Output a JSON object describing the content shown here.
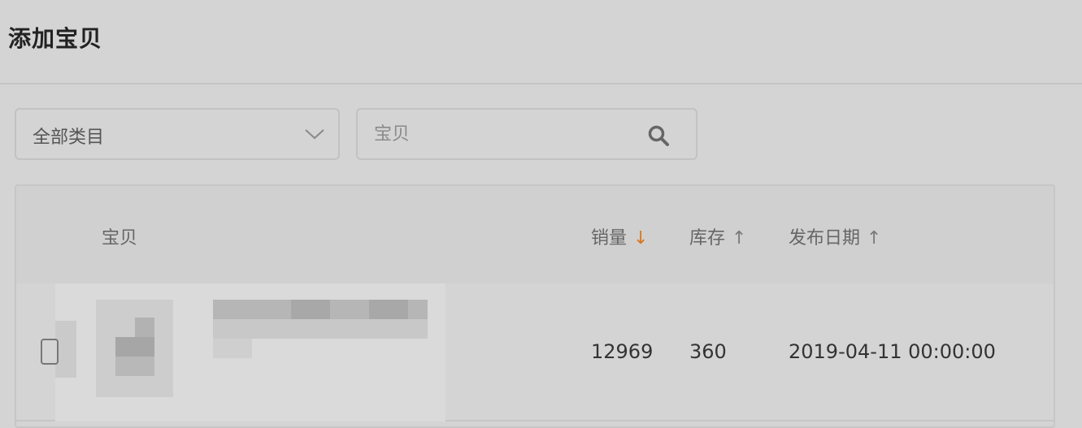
{
  "header": {
    "title": "添加宝贝"
  },
  "filters": {
    "category": {
      "selected": "全部类目"
    },
    "search": {
      "placeholder": "宝贝",
      "value": ""
    }
  },
  "table": {
    "columns": {
      "product": "宝贝",
      "sales": "销量",
      "sales_sort": "↓",
      "stock": "库存",
      "stock_sort": "↑",
      "date": "发布日期",
      "date_sort": "↑"
    },
    "rows": [
      {
        "sales": "12969",
        "stock": "360",
        "date": "2019-04-11 00:00:00",
        "checked": false
      }
    ]
  },
  "colors": {
    "accent_sort": "#d9761e",
    "background": "#d4d4d4",
    "border": "#c4c4c4"
  },
  "icons": {
    "dropdown": "chevron-down-icon",
    "search": "search-icon"
  }
}
